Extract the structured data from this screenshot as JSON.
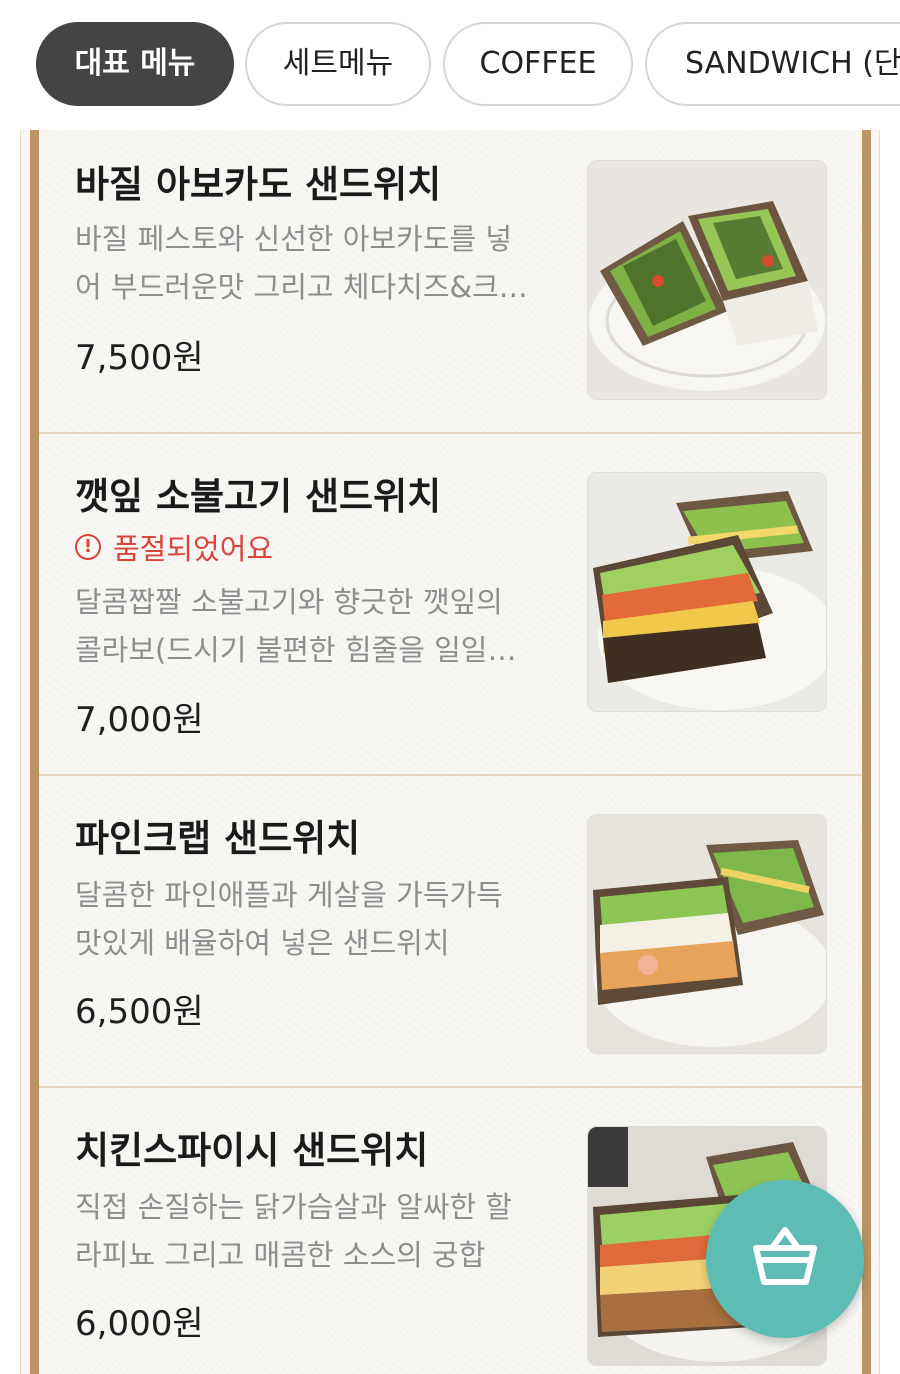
{
  "category_tabs": [
    {
      "label": "대표 메뉴",
      "active": true
    },
    {
      "label": "세트메뉴",
      "active": false
    },
    {
      "label": "COFFEE",
      "active": false
    },
    {
      "label": "SANDWICH (단품)",
      "active": false
    }
  ],
  "menu_items": [
    {
      "name": "바질 아보카도 샌드위치",
      "sold_out": false,
      "description_lines": [
        "바질 페스토와 신선한 아보카도를 넣",
        "어 부드러운맛 그리고 체다치즈&크…"
      ],
      "price": "7,500원",
      "image": "basil-avocado-sandwich-photo"
    },
    {
      "name": "깻잎 소불고기 샌드위치",
      "sold_out": true,
      "sold_out_text": "품절되었어요",
      "description_lines": [
        "달콤짭짤 소불고기와 향긋한 깻잎의",
        "콜라보(드시기 불편한 힘줄을 일일…"
      ],
      "price": "7,000원",
      "image": "perilla-bulgogi-sandwich-photo"
    },
    {
      "name": "파인크랩 샌드위치",
      "sold_out": false,
      "description_lines": [
        "달콤한 파인애플과 게살을 가득가득",
        "맛있게 배율하여 넣은 샌드위치"
      ],
      "price": "6,500원",
      "image": "pine-crab-sandwich-photo"
    },
    {
      "name": "치킨스파이시 샌드위치",
      "sold_out": false,
      "description_lines": [
        "직접 손질하는 닭가슴살과 알싸한 할",
        "라피뇨 그리고 매콤한 소스의 궁합"
      ],
      "price": "6,000원",
      "image": "chicken-spicy-sandwich-photo"
    }
  ],
  "cart_button": {
    "icon": "basket-icon"
  },
  "colors": {
    "active_tab": "#444444",
    "frame": "#b99563",
    "sold_out": "#d9453a",
    "cart": "#5dbdb5"
  }
}
